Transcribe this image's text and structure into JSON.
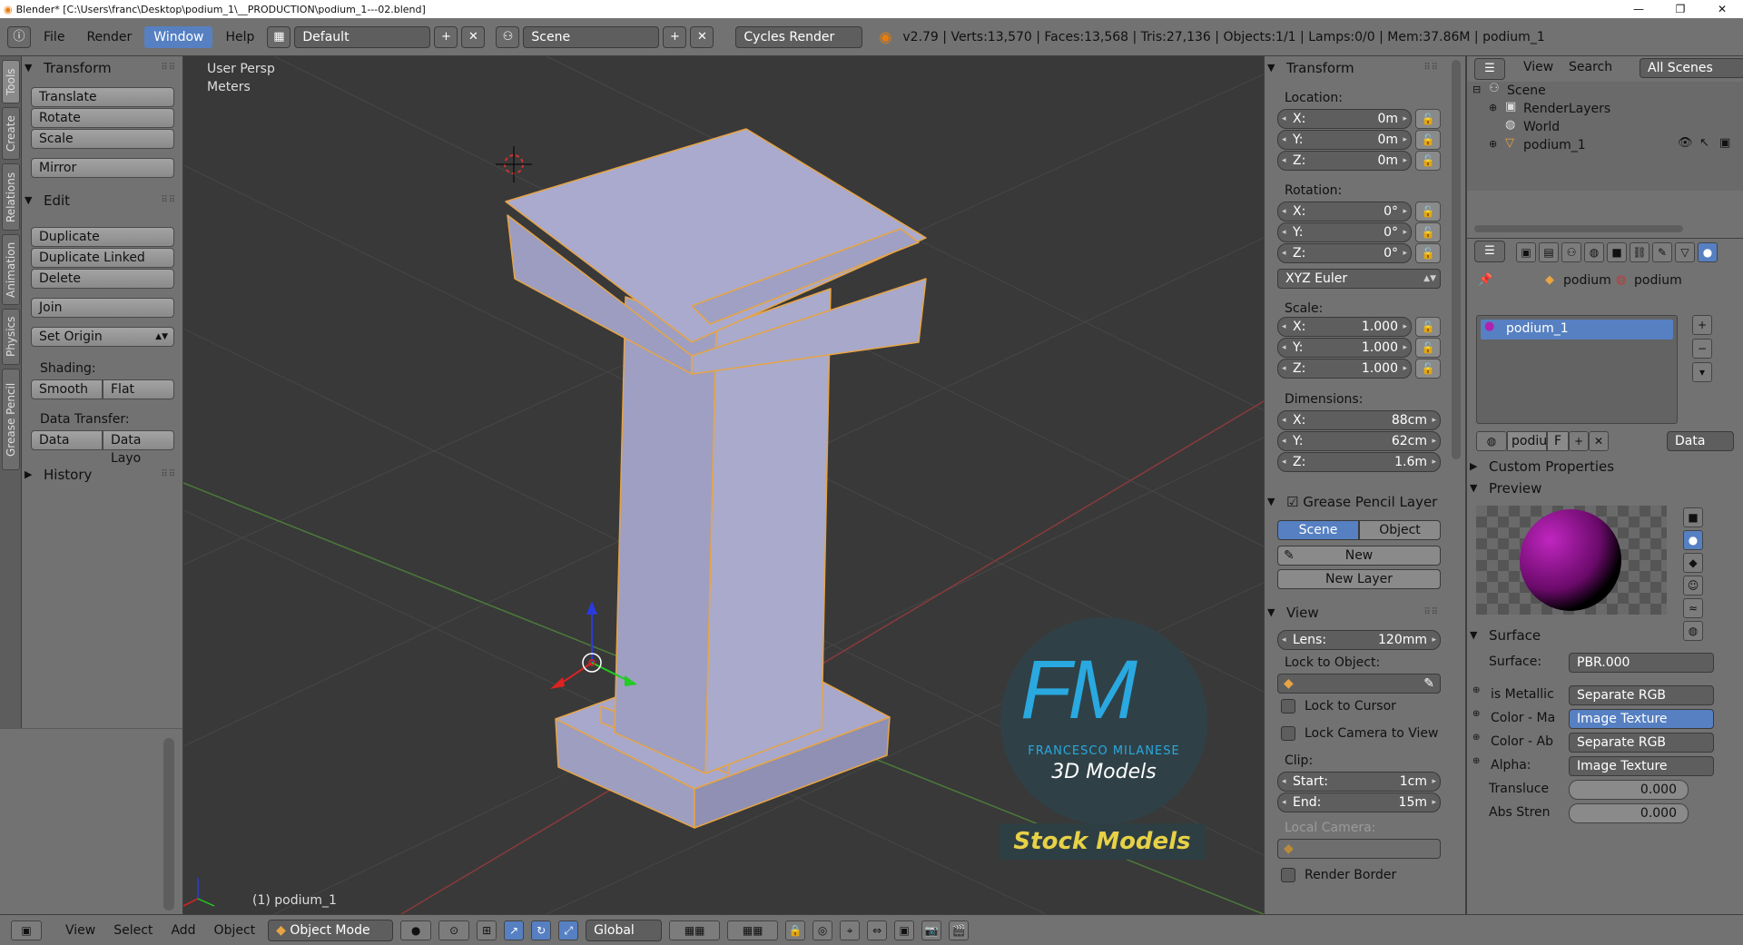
{
  "window": {
    "title": "Blender* [C:\\Users\\franc\\Desktop\\podium_1\\__PRODUCTION\\podium_1---02.blend]",
    "controls": [
      "—",
      "❐",
      "✕"
    ]
  },
  "topbar": {
    "menus": [
      "File",
      "Render",
      "Window",
      "Help"
    ],
    "active_menu": "Window",
    "layout": "Default",
    "scene": "Scene",
    "engine": "Cycles Render",
    "stats": "v2.79 | Verts:13,570 | Faces:13,568 | Tris:27,136 | Objects:1/1 | Lamps:0/0 | Mem:37.86M | podium_1"
  },
  "tool_tabs": [
    "Tools",
    "Create",
    "Relations",
    "Animation",
    "Physics",
    "Grease Pencil"
  ],
  "toolshelf": {
    "transform_header": "Transform",
    "translate": "Translate",
    "rotate": "Rotate",
    "scale": "Scale",
    "mirror": "Mirror",
    "edit_header": "Edit",
    "duplicate": "Duplicate",
    "duplicate_linked": "Duplicate Linked",
    "delete": "Delete",
    "join": "Join",
    "set_origin": "Set Origin",
    "shading_label": "Shading:",
    "smooth": "Smooth",
    "flat": "Flat",
    "data_transfer_label": "Data Transfer:",
    "data": "Data",
    "data_layout": "Data Layo",
    "history_header": "History"
  },
  "viewport": {
    "view_name": "User Persp",
    "units": "Meters",
    "object_label": "(1) podium_1",
    "logo_initials": "FM",
    "logo_name": "FRANCESCO MILANESE",
    "logo_sub": "3D Models",
    "stock_label": "Stock Models"
  },
  "npanel": {
    "transform_header": "Transform",
    "location_label": "Location:",
    "location": {
      "x": "0m",
      "y": "0m",
      "z": "0m"
    },
    "rotation_label": "Rotation:",
    "rotation": {
      "x": "0°",
      "y": "0°",
      "z": "0°"
    },
    "rotation_mode": "XYZ Euler",
    "scale_label": "Scale:",
    "scale": {
      "x": "1.000",
      "y": "1.000",
      "z": "1.000"
    },
    "dimensions_label": "Dimensions:",
    "dimensions": {
      "x": "88cm",
      "y": "62cm",
      "z": "1.6m"
    },
    "axis_x": "X:",
    "axis_y": "Y:",
    "axis_z": "Z:",
    "grease_header": "Grease Pencil Layer",
    "scene_tab": "Scene",
    "object_tab": "Object",
    "new_btn": "New",
    "new_layer": "New Layer",
    "view_header": "View",
    "lens_label": "Lens:",
    "lens_value": "120mm",
    "lock_to_object": "Lock to Object:",
    "lock_to_cursor": "Lock to Cursor",
    "lock_camera": "Lock Camera to View",
    "clip_label": "Clip:",
    "clip_start_label": "Start:",
    "clip_start": "1cm",
    "clip_end_label": "End:",
    "clip_end": "15m",
    "local_camera": "Local Camera:",
    "render_border": "Render Border"
  },
  "outliner": {
    "view": "View",
    "search": "Search",
    "all_scenes": "All Scenes",
    "scene": "Scene",
    "render_layers": "RenderLayers",
    "world": "World",
    "object": "podium_1"
  },
  "properties": {
    "crumb_1": "podium",
    "crumb_2": "podium",
    "material_slot": "podium_1",
    "mat_name": "podiu",
    "mat_f": "F",
    "link_mode": "Data",
    "custom_properties": "Custom Properties",
    "preview": "Preview",
    "surface_header": "Surface",
    "surface_label": "Surface:",
    "surface_value": "PBR.000",
    "rows": [
      {
        "label": "is Metallic",
        "value": "Separate RGB"
      },
      {
        "label": "Color - Ma",
        "value": "Image Texture"
      },
      {
        "label": "Color - Ab",
        "value": "Separate RGB"
      },
      {
        "label": "Alpha:",
        "value": "Image Texture"
      }
    ],
    "translucency_label": "Transluce",
    "translucency_value": "0.000",
    "abs_label": "Abs Stren",
    "abs_value": "0.000"
  },
  "statusbar": {
    "view": "View",
    "select": "Select",
    "add": "Add",
    "object": "Object",
    "mode": "Object Mode",
    "orientation": "Global"
  },
  "colors": {
    "accent": "#5680c2",
    "panel": "#727272",
    "viewport": "#393939",
    "selection_outline": "#e8a444",
    "logo_blue": "#29a9e0",
    "stock_yellow": "#e7d146"
  }
}
